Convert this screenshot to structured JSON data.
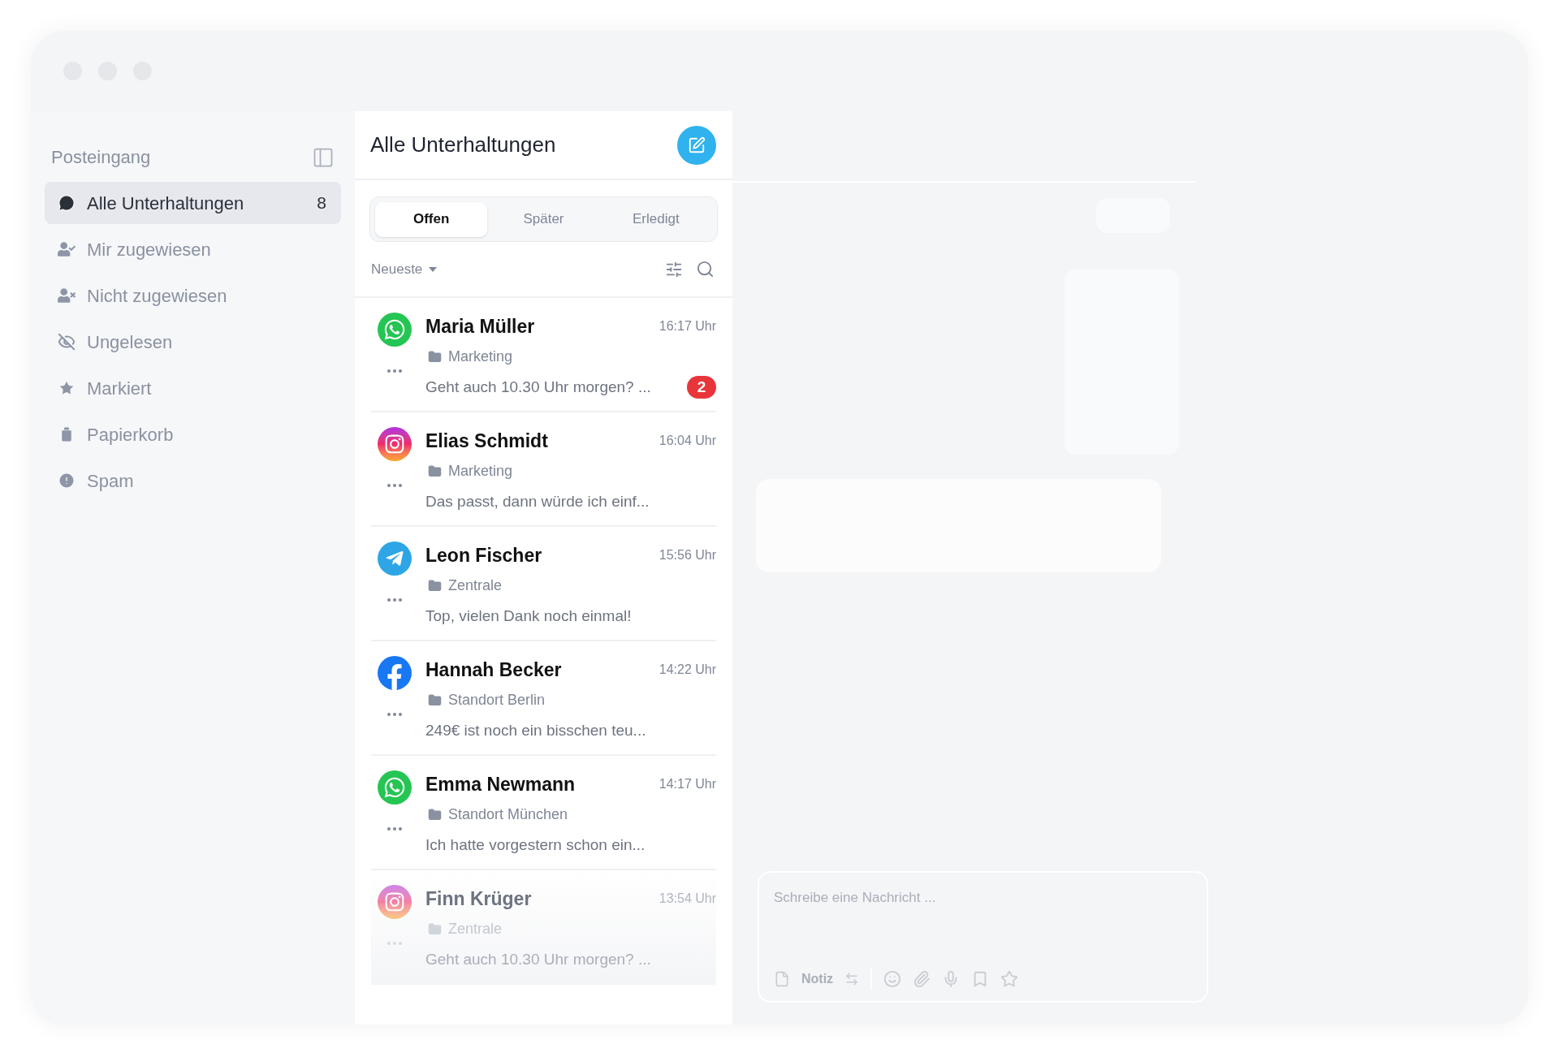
{
  "sidebar": {
    "title": "Posteingang",
    "items": [
      {
        "label": "Alle Unterhaltungen",
        "count": "8",
        "selected": true
      },
      {
        "label": "Mir zugewiesen",
        "selected": false
      },
      {
        "label": "Nicht zugewiesen",
        "selected": false
      },
      {
        "label": "Ungelesen",
        "selected": false
      },
      {
        "label": "Markiert",
        "selected": false
      },
      {
        "label": "Papierkorb",
        "selected": false
      },
      {
        "label": "Spam",
        "selected": false
      }
    ]
  },
  "list": {
    "title": "Alle Unterhaltungen",
    "tabs": [
      {
        "label": "Offen",
        "selected": true
      },
      {
        "label": "Später",
        "selected": false
      },
      {
        "label": "Erledigt",
        "selected": false
      }
    ],
    "sort": "Neueste",
    "rows": [
      {
        "kind": "whatsapp",
        "name": "Maria Müller",
        "time": "16:17 Uhr",
        "folder": "Marketing",
        "preview": "Geht auch 10.30 Uhr morgen? ...",
        "unread": "2",
        "faded": false
      },
      {
        "kind": "instagram",
        "name": "Elias Schmidt",
        "time": "16:04 Uhr",
        "folder": "Marketing",
        "preview": "Das passt, dann würde ich einf...",
        "faded": false
      },
      {
        "kind": "telegram",
        "name": "Leon Fischer",
        "time": "15:56 Uhr",
        "folder": "Zentrale",
        "preview": "Top, vielen Dank noch einmal!",
        "faded": false
      },
      {
        "kind": "facebook",
        "name": "Hannah Becker",
        "time": "14:22 Uhr",
        "folder": "Standort Berlin",
        "preview": "249€ ist noch ein bisschen teu...",
        "faded": false
      },
      {
        "kind": "whatsapp",
        "name": "Emma Newmann",
        "time": "14:17 Uhr",
        "folder": "Standort München",
        "preview": "Ich hatte vorgestern schon ein...",
        "faded": false
      },
      {
        "kind": "instagram",
        "name": "Finn Krüger",
        "time": "13:54 Uhr",
        "folder": "Zentrale",
        "preview": "Geht auch 10.30 Uhr morgen? ...",
        "faded": true
      }
    ]
  },
  "composer": {
    "placeholder": "Schreibe eine Nachricht ...",
    "mode": "Notiz"
  }
}
